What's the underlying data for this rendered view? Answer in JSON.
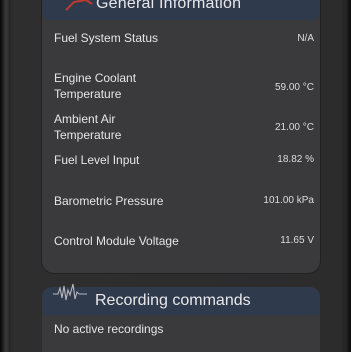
{
  "general_info": {
    "title": "General Information",
    "rows": [
      {
        "label": "Fuel System Status",
        "value": "N/A"
      },
      {
        "label": "Engine Coolant Temperature",
        "label_line1": "Engine Coolant",
        "label_line2": "Temperature",
        "value": "59.00 °C"
      },
      {
        "label": "Ambient Air Temperature",
        "label_line1": "Ambient Air",
        "label_line2": "Temperature",
        "value": "21.00 °C"
      },
      {
        "label": "Fuel Level Input",
        "value": "18.82 %"
      },
      {
        "label": "Barometric Pressure",
        "value": "101.00 kPa"
      },
      {
        "label": "Control Module Voltage",
        "value": "11.65 V"
      }
    ]
  },
  "recording": {
    "title": "Recording commands",
    "status": "No active recordings",
    "icon": "waveform-icon"
  },
  "colors": {
    "background": "#2c2c2d",
    "panel": "#3a3a3c",
    "header": "#2f3a4d",
    "text": "#e6e6e8"
  }
}
